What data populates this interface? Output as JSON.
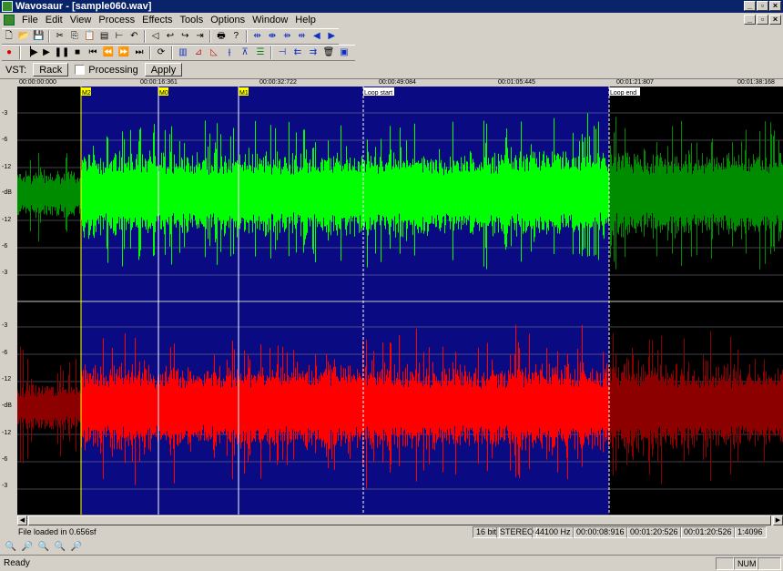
{
  "window": {
    "title": "Wavosaur - [sample060.wav]"
  },
  "menu": [
    "File",
    "Edit",
    "View",
    "Process",
    "Effects",
    "Tools",
    "Options",
    "Window",
    "Help"
  ],
  "vst": {
    "label": "VST:",
    "rack": "Rack",
    "processing": "Processing",
    "apply": "Apply"
  },
  "ruler": [
    "00:00:00:000",
    "00:00:16:361",
    "00:00:32:722",
    "00:00:49:084",
    "00:01:05:445",
    "00:01:21:807",
    "00:01:38:168"
  ],
  "db_scale": [
    "-3",
    "-6",
    "-12",
    "-dB",
    "-12",
    "-6",
    "-3"
  ],
  "markers": {
    "m2": "M2",
    "m0": "M0",
    "m1": "M1",
    "loop_start": "Loop start",
    "loop_end": "Loop end"
  },
  "info": {
    "message": "File loaded in 0.656sf",
    "bits": "16 bit",
    "channels": "STEREO",
    "rate": "44100 Hz",
    "selection_length": "00:00:08:916",
    "sel_start": "00:01:20:526",
    "sel_end": "00:01:20:526",
    "zoom": "1:4096"
  },
  "status": {
    "ready": "Ready",
    "num": "NUM"
  },
  "colors": {
    "selection": "#0a0a82",
    "background": "#000000",
    "left_channel": "#00ff00",
    "left_channel_dim": "#008c00",
    "right_channel": "#ff0000",
    "right_channel_dim": "#8c0000",
    "title_bar": "#0a246a"
  }
}
